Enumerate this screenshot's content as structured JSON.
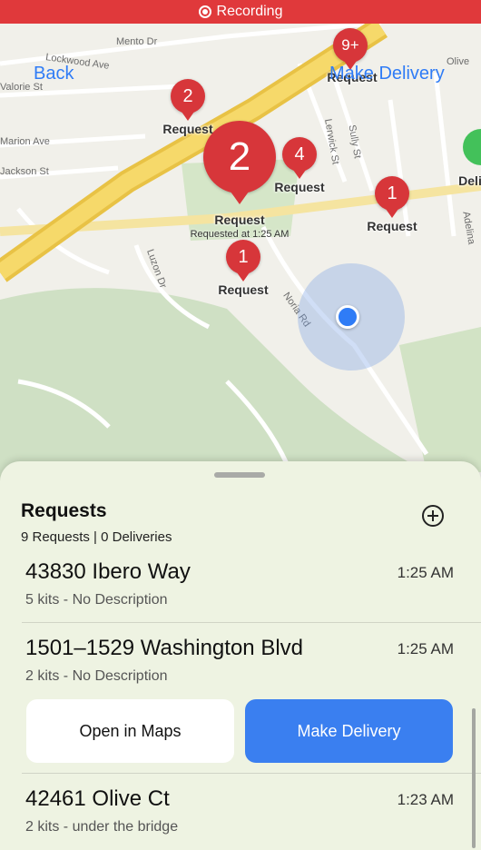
{
  "recording": {
    "label": "Recording"
  },
  "nav": {
    "back": "Back",
    "action": "Make Delivery"
  },
  "streets": [
    "Mento Dr",
    "Lockwood Ave",
    "Valorie St",
    "Marion Ave",
    "Jackson St",
    "Olive",
    "Lerwick St",
    "Sully St",
    "Luzon Dr",
    "Noria Rd",
    "Adelina"
  ],
  "pins": [
    {
      "count": "2",
      "label": "Request"
    },
    {
      "count": "2",
      "label": "Request",
      "sub": "Requested at 1:25 AM"
    },
    {
      "count": "4",
      "label": "Request"
    },
    {
      "count": "1",
      "label": "Request"
    },
    {
      "count": "1",
      "label": "Request"
    },
    {
      "count": "9+",
      "label": "Request"
    }
  ],
  "partial_label": "Deli",
  "sheet": {
    "title": "Requests",
    "subtitle": "9 Requests | 0 Deliveries",
    "items": [
      {
        "address": "43830 Ibero Way",
        "time": "1:25 AM",
        "desc": "5 kits - No Description"
      },
      {
        "address": "1501–1529 Washington Blvd",
        "time": "1:25 AM",
        "desc": "2 kits - No Description"
      },
      {
        "address": "42461 Olive Ct",
        "time": "1:23 AM",
        "desc": "2 kits - under the bridge"
      }
    ],
    "buttons": {
      "open_maps": "Open in Maps",
      "make_delivery": "Make Delivery"
    }
  },
  "colors": {
    "accent": "#2f7cf6",
    "pin": "#d7363a",
    "recording": "#e0393b",
    "highway": "#f2cf58"
  }
}
